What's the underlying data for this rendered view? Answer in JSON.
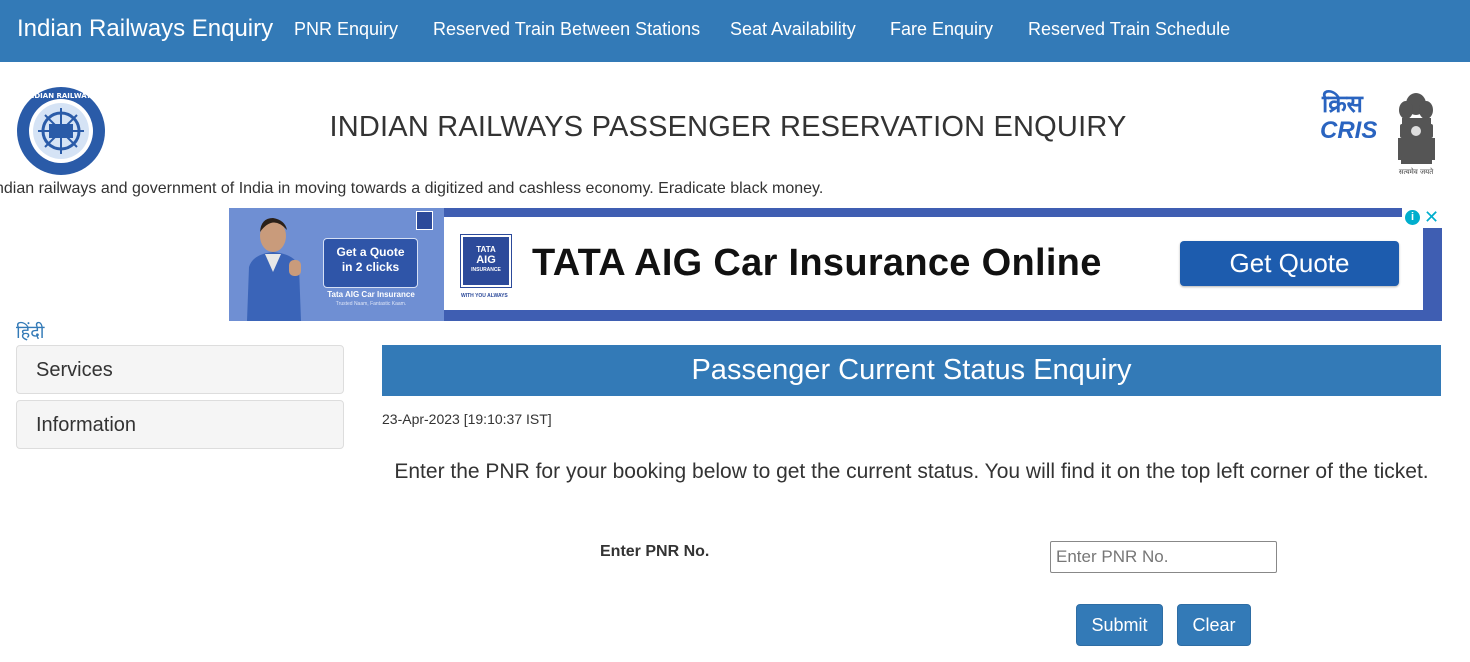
{
  "navbar": {
    "brand": "Indian Railways Enquiry",
    "items": [
      {
        "label": "PNR Enquiry"
      },
      {
        "label": "Reserved Train Between Stations"
      },
      {
        "label": "Seat Availability"
      },
      {
        "label": "Fare Enquiry"
      },
      {
        "label": "Reserved Train Schedule"
      }
    ]
  },
  "header": {
    "title": "INDIAN RAILWAYS PASSENGER RESERVATION ENQUIRY",
    "left_logo_text": "INDIAN RAILWAYS",
    "right_logo_text": "CRIS",
    "right_logo_hindi": "क्रिस",
    "emblem_caption": "सत्यमेव जयते",
    "marquee": "ndian railways and government of India in moving towards a digitized and cashless economy. Eradicate black money."
  },
  "ad": {
    "bubble_line1": "Get a Quote",
    "bubble_line2": "in 2 clicks",
    "small_brand": "Tata AIG Car Insurance",
    "small_tag": "Trusted Naam, Fantastic Kaam.",
    "logo_line1": "TATA",
    "logo_line2": "AIG",
    "logo_line3": "INSURANCE",
    "tagline": "WITH YOU ALWAYS",
    "headline": "TATA AIG Car Insurance Online",
    "cta": "Get Quote",
    "info_icon": "i",
    "close_icon": "✕",
    "colors": {
      "background": "#3f5eb2",
      "cta": "#1d5cae",
      "adchoices": "#00aecd"
    }
  },
  "sidebar": {
    "language_link": "हिंदी",
    "panels": [
      {
        "label": "Services"
      },
      {
        "label": "Information"
      }
    ]
  },
  "main": {
    "heading": "Passenger Current Status Enquiry",
    "datetime": "23-Apr-2023 [19:10:37 IST]",
    "instructions": "Enter the PNR for your booking below to get the current status. You will find it on the top left corner of the ticket.",
    "pnr_label": "Enter PNR No.",
    "pnr_value": "",
    "pnr_placeholder": "Enter PNR No.",
    "submit_label": "Submit",
    "clear_label": "Clear"
  },
  "colors": {
    "primary": "#337ab7",
    "panel_bg": "#f5f5f5"
  }
}
